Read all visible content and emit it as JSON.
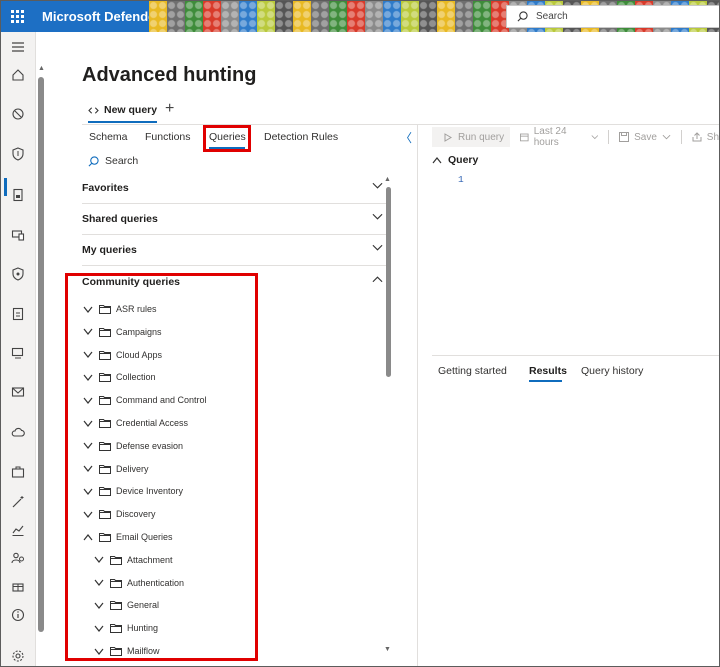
{
  "app": {
    "brand": "Microsoft Defender",
    "search_placeholder": "Search"
  },
  "page": {
    "title": "Advanced hunting"
  },
  "query_tabs": {
    "new_query_label": "New query",
    "add_label": "+"
  },
  "left_tabs": [
    "Schema",
    "Functions",
    "Queries",
    "Detection Rules"
  ],
  "left_search": {
    "placeholder": "Search"
  },
  "sections": {
    "favorites": "Favorites",
    "shared": "Shared queries",
    "my": "My queries",
    "community": "Community queries"
  },
  "community_folders": [
    {
      "label": "ASR rules",
      "expanded": false,
      "level": 0
    },
    {
      "label": "Campaigns",
      "expanded": false,
      "level": 0
    },
    {
      "label": "Cloud Apps",
      "expanded": false,
      "level": 0
    },
    {
      "label": "Collection",
      "expanded": false,
      "level": 0
    },
    {
      "label": "Command and Control",
      "expanded": false,
      "level": 0
    },
    {
      "label": "Credential Access",
      "expanded": false,
      "level": 0
    },
    {
      "label": "Defense evasion",
      "expanded": false,
      "level": 0
    },
    {
      "label": "Delivery",
      "expanded": false,
      "level": 0
    },
    {
      "label": "Device Inventory",
      "expanded": false,
      "level": 0
    },
    {
      "label": "Discovery",
      "expanded": false,
      "level": 0
    },
    {
      "label": "Email Queries",
      "expanded": true,
      "level": 0
    },
    {
      "label": "Attachment",
      "expanded": false,
      "level": 1
    },
    {
      "label": "Authentication",
      "expanded": false,
      "level": 1
    },
    {
      "label": "General",
      "expanded": false,
      "level": 1
    },
    {
      "label": "Hunting",
      "expanded": false,
      "level": 1
    },
    {
      "label": "Mailflow",
      "expanded": false,
      "level": 1
    }
  ],
  "toolbar": {
    "run": "Run query",
    "time": "Last 24 hours",
    "save": "Save",
    "share": "Sh"
  },
  "editor": {
    "header": "Query",
    "line": "1"
  },
  "result_tabs": {
    "getting_started": "Getting started",
    "results": "Results",
    "history": "Query history"
  },
  "colors": {
    "accent": "#0f6cbd",
    "topbar": "#1d6fc4",
    "highlight": "#e00000"
  }
}
